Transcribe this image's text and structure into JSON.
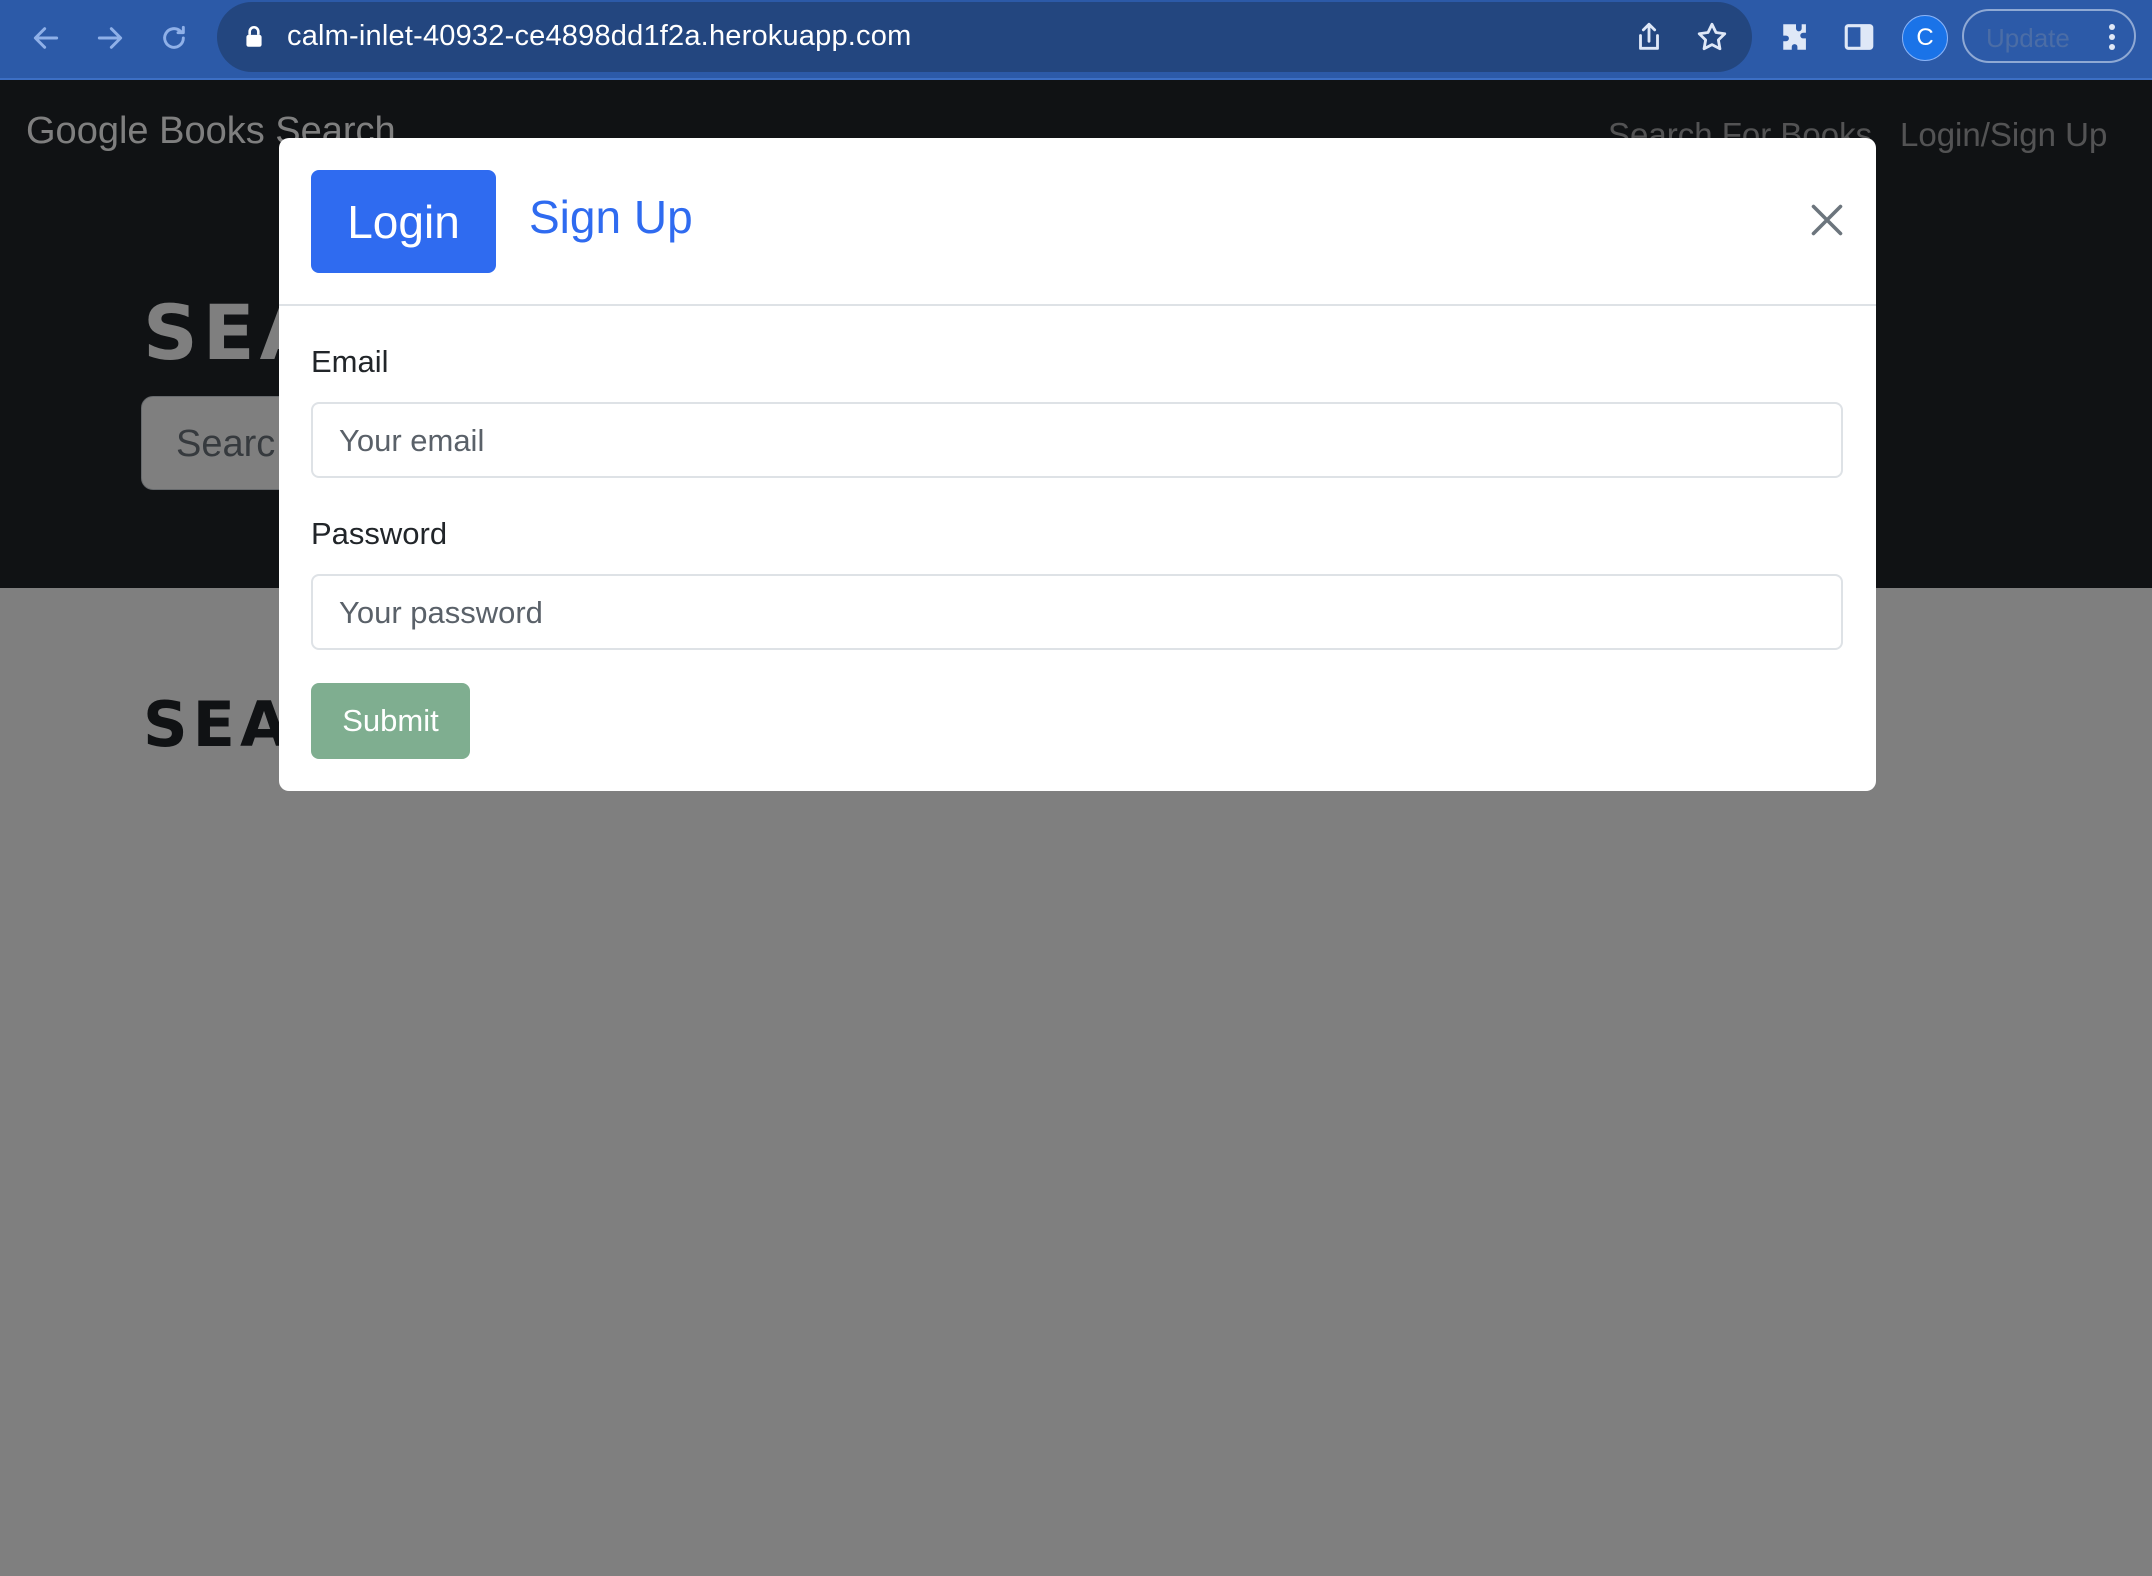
{
  "browser": {
    "url": "calm-inlet-40932-ce4898dd1f2a.herokuapp.com",
    "profile_initial": "C",
    "update_label": "Update",
    "icons": {
      "back": "arrow-left-icon",
      "forward": "arrow-right-icon",
      "reload": "reload-icon",
      "lock": "lock-icon",
      "share": "share-icon",
      "bookmark": "star-icon",
      "extensions": "puzzle-icon",
      "side_panel": "side-panel-icon",
      "menu": "kebab-menu-icon"
    }
  },
  "navbar": {
    "brand": "Google Books Search",
    "links": [
      "Search For Books",
      "Login/Sign Up"
    ]
  },
  "hero": {
    "title": "SEA",
    "search_placeholder": "Searc"
  },
  "results": {
    "title": "SEA"
  },
  "modal": {
    "tabs": {
      "login": "Login",
      "signup": "Sign Up",
      "active": "Login"
    },
    "email_label": "Email",
    "email_placeholder": "Your email",
    "password_label": "Password",
    "password_placeholder": "Your password",
    "submit_label": "Submit",
    "close_icon": "close-icon"
  },
  "colors": {
    "chrome": "#2c5aa8",
    "primary": "#2f6bf0",
    "submit_disabled": "#7fae90",
    "hero_bg": "#212529"
  }
}
